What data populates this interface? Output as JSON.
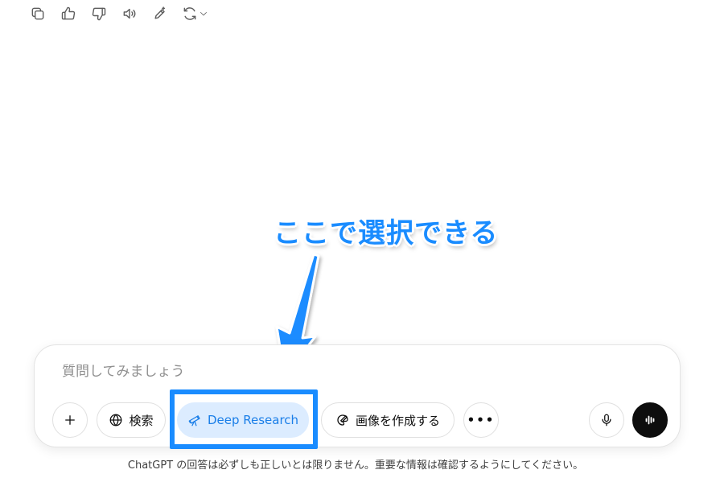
{
  "message_actions": {
    "copy_icon": "copy-icon",
    "like_icon": "thumbs-up-icon",
    "dislike_icon": "thumbs-down-icon",
    "read_aloud_icon": "speaker-icon",
    "edit_icon": "pen-sparkle-icon",
    "regenerate_icon": "refresh-icon"
  },
  "annotation": {
    "text": "ここで選択できる",
    "color": "#1a8cff"
  },
  "composer": {
    "placeholder": "質問してみましょう",
    "tools": {
      "search_label": "検索",
      "deep_research_label": "Deep Research",
      "image_label": "画像を作成する",
      "more_label": "•••"
    }
  },
  "colors": {
    "accent": "#1a8cff",
    "deep_research_bg": "#dcecff",
    "deep_research_text": "#1a7ee8",
    "voice_button": "#0d0d0d"
  },
  "disclaimer": "ChatGPT の回答は必ずしも正しいとは限りません。重要な情報は確認するようにしてください。"
}
